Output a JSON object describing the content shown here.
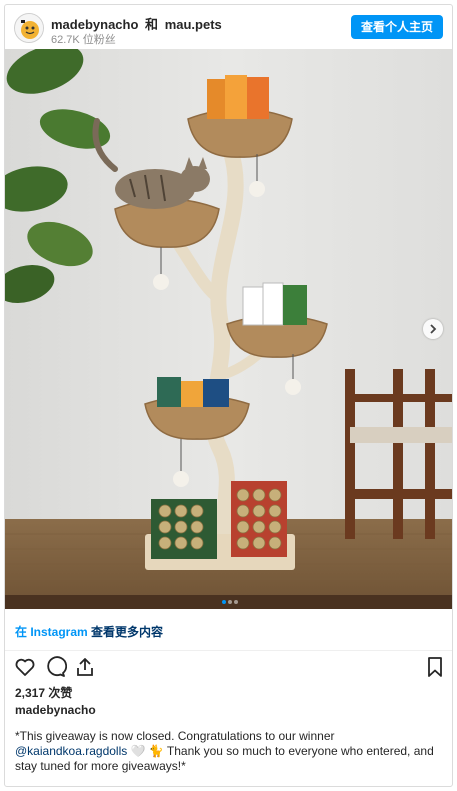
{
  "header": {
    "account1": "madebynacho",
    "separator": "和",
    "account2": "mau.pets",
    "followers": "62.7K 位粉丝",
    "profile_button": "查看个人主页"
  },
  "post": {
    "carousel": {
      "total": 3,
      "active": 1
    }
  },
  "view_more": {
    "prefix": "在 Instagram",
    "suffix": " 查看更多内容"
  },
  "actions": {
    "like_icon": "heart-icon",
    "comment_icon": "comment-icon",
    "share_icon": "share-icon",
    "save_icon": "bookmark-icon"
  },
  "likes": "2,317 次赞",
  "caption": {
    "owner": "madebynacho",
    "text1": "*This giveaway is now closed. Congratulations to our winner",
    "mention": "@kaiandkoa.ragdolls",
    "text2": " 🤍 🐈 Thank you so much to everyone who entered, and stay tuned for more giveaways!*"
  },
  "colors": {
    "primary_button": "#0095f6",
    "link": "#00376b",
    "secondary_text": "#8e8e8e"
  }
}
